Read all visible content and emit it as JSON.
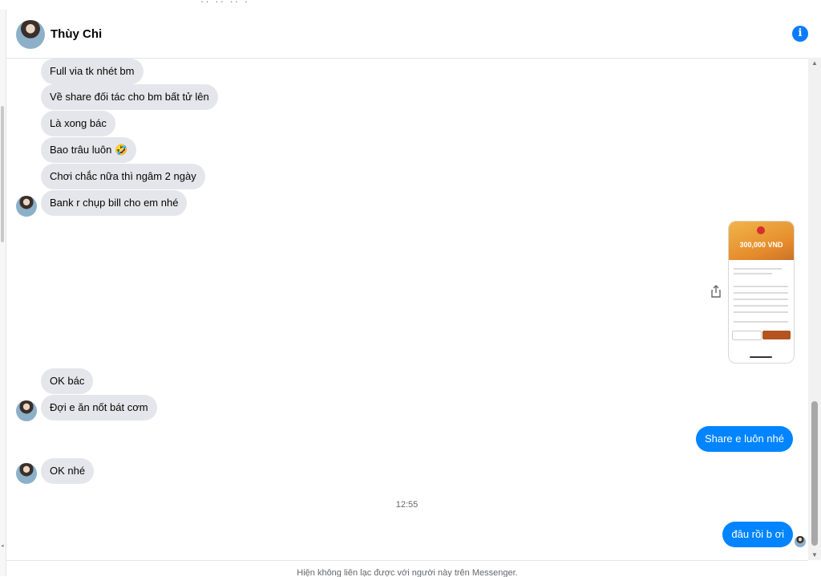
{
  "header": {
    "contact_name": "Thùy Chi",
    "info_icon": "info-icon"
  },
  "messages": [
    {
      "side": "in",
      "text": "Full via tk nhét bm"
    },
    {
      "side": "in",
      "text": "Về share đối tác cho bm bất tử lên"
    },
    {
      "side": "in",
      "text": "Là xong bác"
    },
    {
      "side": "in",
      "text": "Bao trâu luôn 🤣"
    },
    {
      "side": "in",
      "text": "Chơi chắc nữa thì ngâm 2 ngày"
    },
    {
      "side": "in",
      "text": "Bank r chụp bill cho em nhé"
    },
    {
      "side": "out",
      "text": "[image: bank transfer receipt]"
    },
    {
      "side": "in",
      "text": "OK bác"
    },
    {
      "side": "in",
      "text": "Đợi e ăn nốt bát cơm"
    },
    {
      "side": "out",
      "text": "Share e luôn nhé"
    },
    {
      "side": "in",
      "text": "OK nhé"
    },
    {
      "side": "out",
      "text": "đâu rồi b ơi"
    }
  ],
  "receipt_image": {
    "amount": "300,000 VND"
  },
  "timestamp": "12:55",
  "footer": {
    "notice": "Hiện không liên lạc được với người này trên Messenger."
  },
  "colors": {
    "accent": "#0084ff",
    "incoming_bubble": "#e4e6eb",
    "info_button": "#0a7cff"
  }
}
